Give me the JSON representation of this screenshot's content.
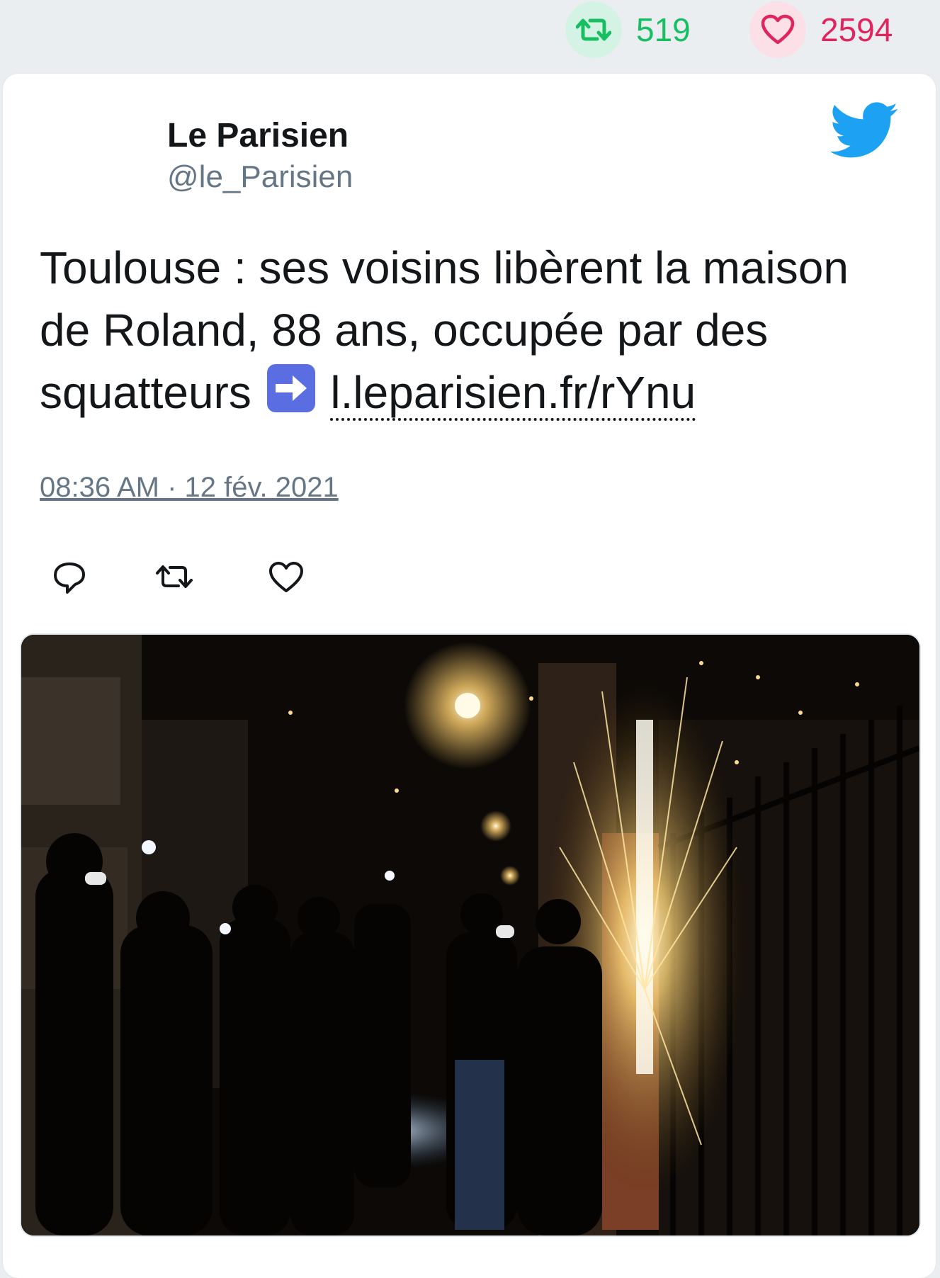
{
  "stats": {
    "retweets": "519",
    "likes": "2594"
  },
  "author": {
    "name": "Le Parisien",
    "handle": "@le_Parisien"
  },
  "tweet": {
    "text": "Toulouse : ses voisins libèrent la maison de Roland, 88 ans, occupée par des squatteurs",
    "link": "l.leparisien.fr/rYnu",
    "timestamp": "08:36 AM · 12 fév. 2021"
  },
  "colors": {
    "retweet": "#17bf63",
    "like": "#e0245e",
    "twitter_blue": "#1da1f2",
    "muted": "#657786"
  },
  "icons": {
    "retweet_stat": "retweet-icon",
    "like_stat": "heart-icon",
    "brand": "twitter-bird-icon",
    "emoji": "right-arrow-emoji-icon",
    "reply": "reply-icon",
    "retweet": "retweet-icon",
    "like": "heart-icon"
  }
}
